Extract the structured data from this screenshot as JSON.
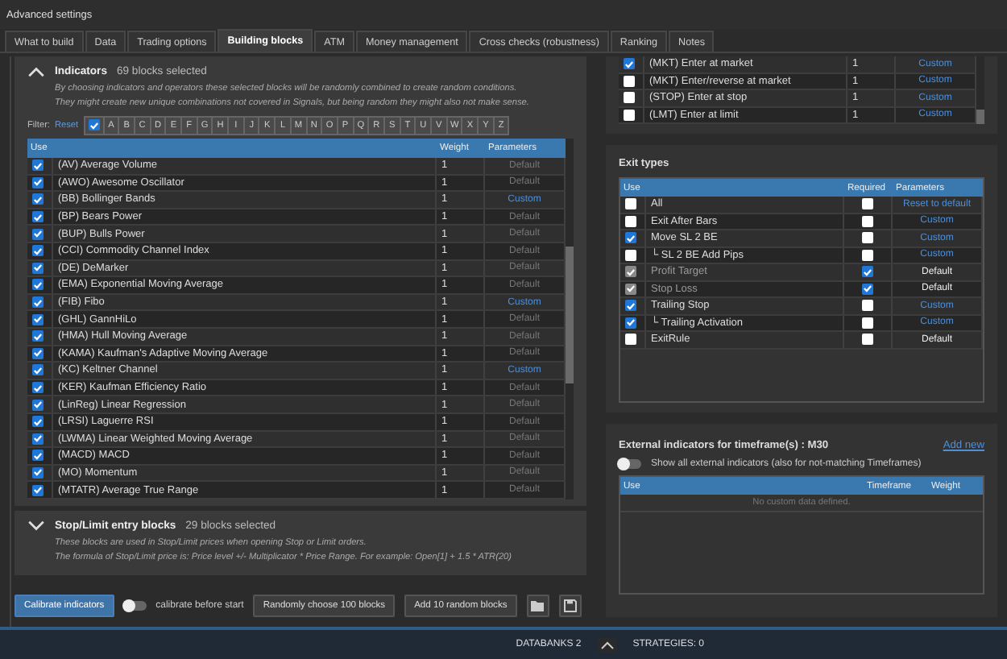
{
  "window": {
    "title": "Advanced settings"
  },
  "tabs": [
    {
      "label": "What to build",
      "selected": false
    },
    {
      "label": "Data",
      "selected": false
    },
    {
      "label": "Trading options",
      "selected": false
    },
    {
      "label": "Building blocks",
      "selected": true
    },
    {
      "label": "ATM",
      "selected": false
    },
    {
      "label": "Money management",
      "selected": false
    },
    {
      "label": "Cross checks (robustness)",
      "selected": false
    },
    {
      "label": "Ranking",
      "selected": false
    },
    {
      "label": "Notes",
      "selected": false
    }
  ],
  "indicators": {
    "expanded": true,
    "title": "Indicators",
    "count": "69 blocks selected",
    "description": [
      "By choosing indicators and operators these selected blocks will be randomly combined to create random conditions.",
      "They might create new unique combinations not covered in Signals, but being random they might also not make sense."
    ],
    "filter": {
      "label": "Filter:",
      "reset": "Reset",
      "all_checked": true,
      "letters": [
        "A",
        "B",
        "C",
        "D",
        "E",
        "F",
        "G",
        "H",
        "I",
        "J",
        "K",
        "L",
        "M",
        "N",
        "O",
        "P",
        "Q",
        "R",
        "S",
        "T",
        "U",
        "V",
        "W",
        "X",
        "Y",
        "Z"
      ]
    },
    "columns": [
      "Use",
      "Weight",
      "Parameters"
    ],
    "rows": [
      {
        "checked": true,
        "name": "(AV) Average Volume",
        "weight": "1",
        "parameters": "Default",
        "link": false
      },
      {
        "checked": true,
        "name": "(AWO) Awesome Oscillator",
        "weight": "1",
        "parameters": "Default",
        "link": false
      },
      {
        "checked": true,
        "name": "(BB) Bollinger Bands",
        "weight": "1",
        "parameters": "Custom",
        "link": true
      },
      {
        "checked": true,
        "name": "(BP) Bears Power",
        "weight": "1",
        "parameters": "Default",
        "link": false
      },
      {
        "checked": true,
        "name": "(BUP) Bulls Power",
        "weight": "1",
        "parameters": "Default",
        "link": false
      },
      {
        "checked": true,
        "name": "(CCI) Commodity Channel Index",
        "weight": "1",
        "parameters": "Default",
        "link": false
      },
      {
        "checked": true,
        "name": "(DE) DeMarker",
        "weight": "1",
        "parameters": "Default",
        "link": false
      },
      {
        "checked": true,
        "name": "(EMA) Exponential Moving Average",
        "weight": "1",
        "parameters": "Default",
        "link": false
      },
      {
        "checked": true,
        "name": "(FIB) Fibo",
        "weight": "1",
        "parameters": "Custom",
        "link": true
      },
      {
        "checked": true,
        "name": "(GHL) GannHiLo",
        "weight": "1",
        "parameters": "Default",
        "link": false
      },
      {
        "checked": true,
        "name": "(HMA) Hull Moving Average",
        "weight": "1",
        "parameters": "Default",
        "link": false
      },
      {
        "checked": true,
        "name": "(KAMA) Kaufman's Adaptive Moving Average",
        "weight": "1",
        "parameters": "Default",
        "link": false
      },
      {
        "checked": true,
        "name": "(KC) Keltner Channel",
        "weight": "1",
        "parameters": "Custom",
        "link": true
      },
      {
        "checked": true,
        "name": "(KER) Kaufman Efficiency Ratio",
        "weight": "1",
        "parameters": "Default",
        "link": false
      },
      {
        "checked": true,
        "name": "(LinReg) Linear Regression",
        "weight": "1",
        "parameters": "Default",
        "link": false
      },
      {
        "checked": true,
        "name": "(LRSI) Laguerre RSI",
        "weight": "1",
        "parameters": "Default",
        "link": false
      },
      {
        "checked": true,
        "name": "(LWMA) Linear Weighted Moving Average",
        "weight": "1",
        "parameters": "Default",
        "link": false
      },
      {
        "checked": true,
        "name": "(MACD) MACD",
        "weight": "1",
        "parameters": "Default",
        "link": false
      },
      {
        "checked": true,
        "name": "(MO) Momentum",
        "weight": "1",
        "parameters": "Default",
        "link": false
      },
      {
        "checked": true,
        "name": "(MTATR) Average True Range",
        "weight": "1",
        "parameters": "Default",
        "link": false
      }
    ]
  },
  "stop_limit": {
    "expanded": false,
    "title": "Stop/Limit entry blocks",
    "count": "29 blocks selected",
    "description": [
      "These blocks are used in Stop/Limit prices when opening Stop or Limit orders.",
      "The formula of Stop/Limit price is: Price level +/- Multiplicator * Price Range. For example: Open[1] + 1.5 * ATR(20)"
    ]
  },
  "actions": {
    "calibrate": "Calibrate indicators",
    "calibrate_before_start": {
      "label": "calibrate before start",
      "on": false
    },
    "randomly_choose": "Randomly choose 100 blocks",
    "add_random": "Add 10 random blocks"
  },
  "entry_types": [
    {
      "checked": true,
      "name": "(MKT) Enter at market",
      "weight": "1",
      "parameters": "Custom"
    },
    {
      "checked": false,
      "name": "(MKT) Enter/reverse at market",
      "weight": "1",
      "parameters": "Custom"
    },
    {
      "checked": false,
      "name": "(STOP) Enter at stop",
      "weight": "1",
      "parameters": "Custom"
    },
    {
      "checked": false,
      "name": "(LMT) Enter at limit",
      "weight": "1",
      "parameters": "Custom"
    }
  ],
  "exit_types": {
    "title": "Exit types",
    "columns": [
      "Use",
      "Required",
      "Parameters"
    ],
    "rows": [
      {
        "checked": false,
        "disabled": false,
        "name": "All",
        "required": false,
        "parameters": "Reset to default",
        "link": true
      },
      {
        "checked": false,
        "disabled": false,
        "name": "Exit After Bars",
        "required": false,
        "parameters": "Custom",
        "link": true
      },
      {
        "checked": true,
        "disabled": false,
        "name": "Move SL 2 BE",
        "required": false,
        "parameters": "Custom",
        "link": true
      },
      {
        "checked": false,
        "disabled": false,
        "name": "└ SL 2 BE Add Pips",
        "required": false,
        "parameters": "Custom",
        "link": true
      },
      {
        "checked": true,
        "disabled": true,
        "name": "Profit Target",
        "required": true,
        "parameters": "Default",
        "link": false
      },
      {
        "checked": true,
        "disabled": true,
        "name": "Stop Loss",
        "required": true,
        "parameters": "Default",
        "link": false
      },
      {
        "checked": true,
        "disabled": false,
        "name": "Trailing Stop",
        "required": false,
        "parameters": "Custom",
        "link": true
      },
      {
        "checked": true,
        "disabled": false,
        "name": "└ Trailing Activation",
        "required": false,
        "parameters": "Custom",
        "link": true
      },
      {
        "checked": false,
        "disabled": false,
        "name": "ExitRule",
        "required": false,
        "parameters": "Default",
        "link": false
      }
    ]
  },
  "external": {
    "title": "External indicators for timeframe(s) : M30",
    "add_new": "Add new",
    "show_all": {
      "label": "Show all external indicators (also for not-matching Timeframes)",
      "on": false
    },
    "columns": [
      "Use",
      "Timeframe",
      "Weight"
    ],
    "empty": "No custom data defined."
  },
  "status_bar": {
    "databanks": "DATABANKS 2",
    "strategies": "STRATEGIES: 0"
  }
}
